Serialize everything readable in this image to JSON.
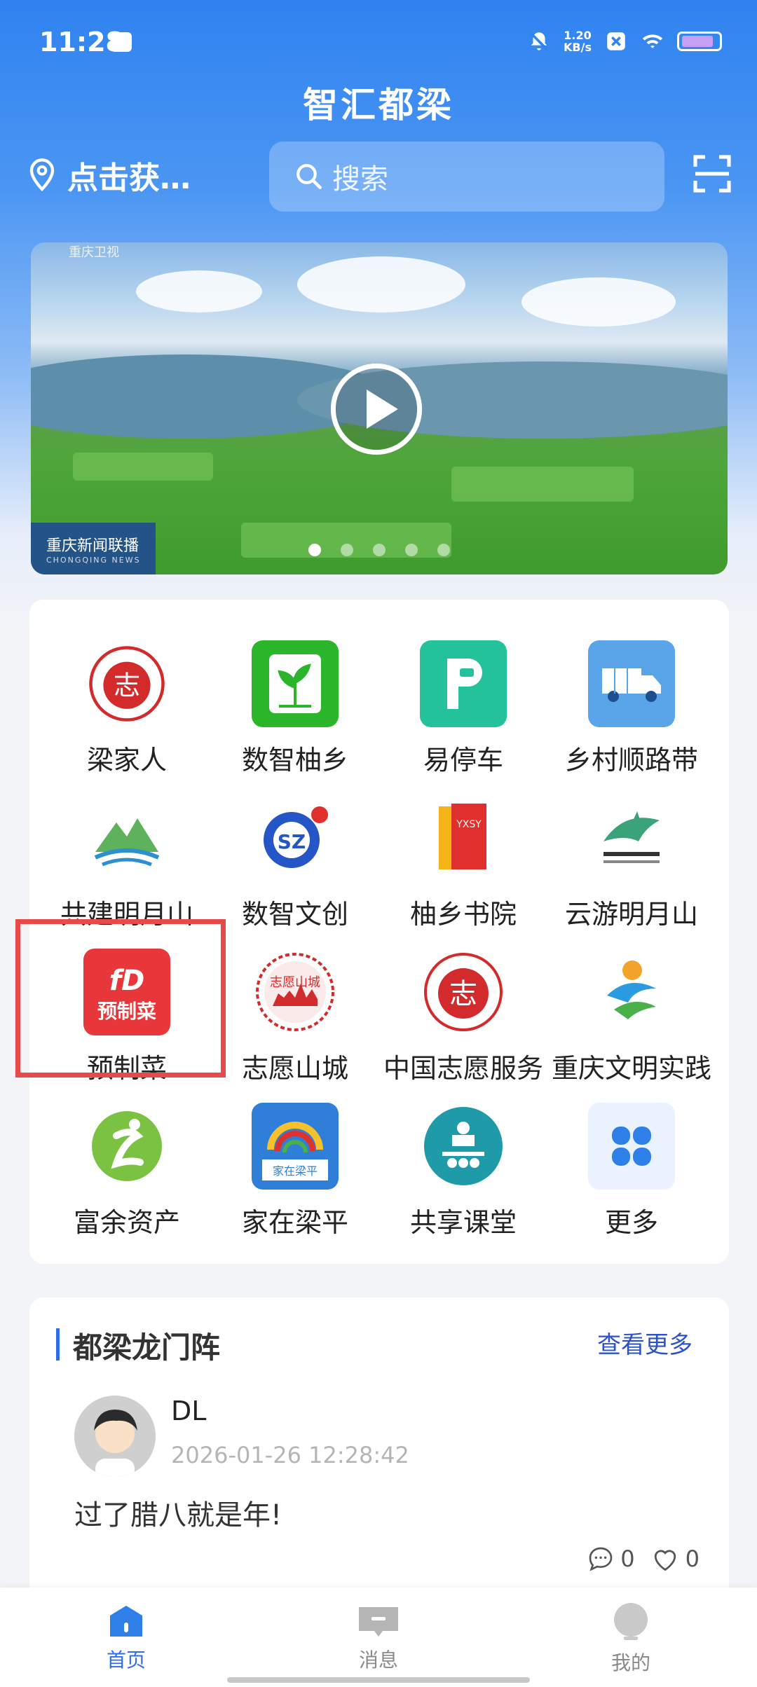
{
  "status": {
    "time": "11:28",
    "net_speed_top": "1.20",
    "net_speed_unit": "KB/s"
  },
  "header": {
    "title": "智汇都梁",
    "location": "点击获…",
    "search_placeholder": "搜索"
  },
  "banner": {
    "tv_mark": "重庆卫视",
    "news_title": "重庆新闻联播",
    "news_sub": "CHONGQING NEWS",
    "slides": 5,
    "active_slide": 1
  },
  "services": [
    {
      "label": "梁家人",
      "icon": "volunteer-badge-icon"
    },
    {
      "label": "数智柚乡",
      "icon": "tree-icon"
    },
    {
      "label": "易停车",
      "icon": "parking-icon"
    },
    {
      "label": "乡村顺路带",
      "icon": "truck-icon"
    },
    {
      "label": "共建明月山",
      "icon": "mountain-logo-icon"
    },
    {
      "label": "数智文创",
      "icon": "sz-logo-icon"
    },
    {
      "label": "柚乡书院",
      "icon": "book-icon"
    },
    {
      "label": "云游明月山",
      "icon": "scenic-logo-icon"
    },
    {
      "label": "预制菜",
      "icon": "prepared-food-icon"
    },
    {
      "label": "志愿山城",
      "icon": "volunteer-city-icon"
    },
    {
      "label": "中国志愿服务",
      "icon": "china-volunteer-icon"
    },
    {
      "label": "重庆文明实践",
      "icon": "civilization-icon"
    },
    {
      "label": "富余资产",
      "icon": "asset-icon"
    },
    {
      "label": "家在梁平",
      "icon": "home-liangping-icon"
    },
    {
      "label": "共享课堂",
      "icon": "classroom-icon"
    },
    {
      "label": "更多",
      "icon": "more-grid-icon"
    }
  ],
  "feed": {
    "section_title": "都梁龙门阵",
    "more_label": "查看更多",
    "post": {
      "user": "DL",
      "time": "2026-01-26 12:28:42",
      "content": "过了腊八就是年!",
      "comments": "0",
      "likes": "0"
    }
  },
  "tabs": [
    {
      "label": "首页",
      "active": true
    },
    {
      "label": "消息",
      "active": false
    },
    {
      "label": "我的",
      "active": false
    }
  ],
  "colors": {
    "primary": "#2f6ee8",
    "highlight": "#e84a4a"
  }
}
